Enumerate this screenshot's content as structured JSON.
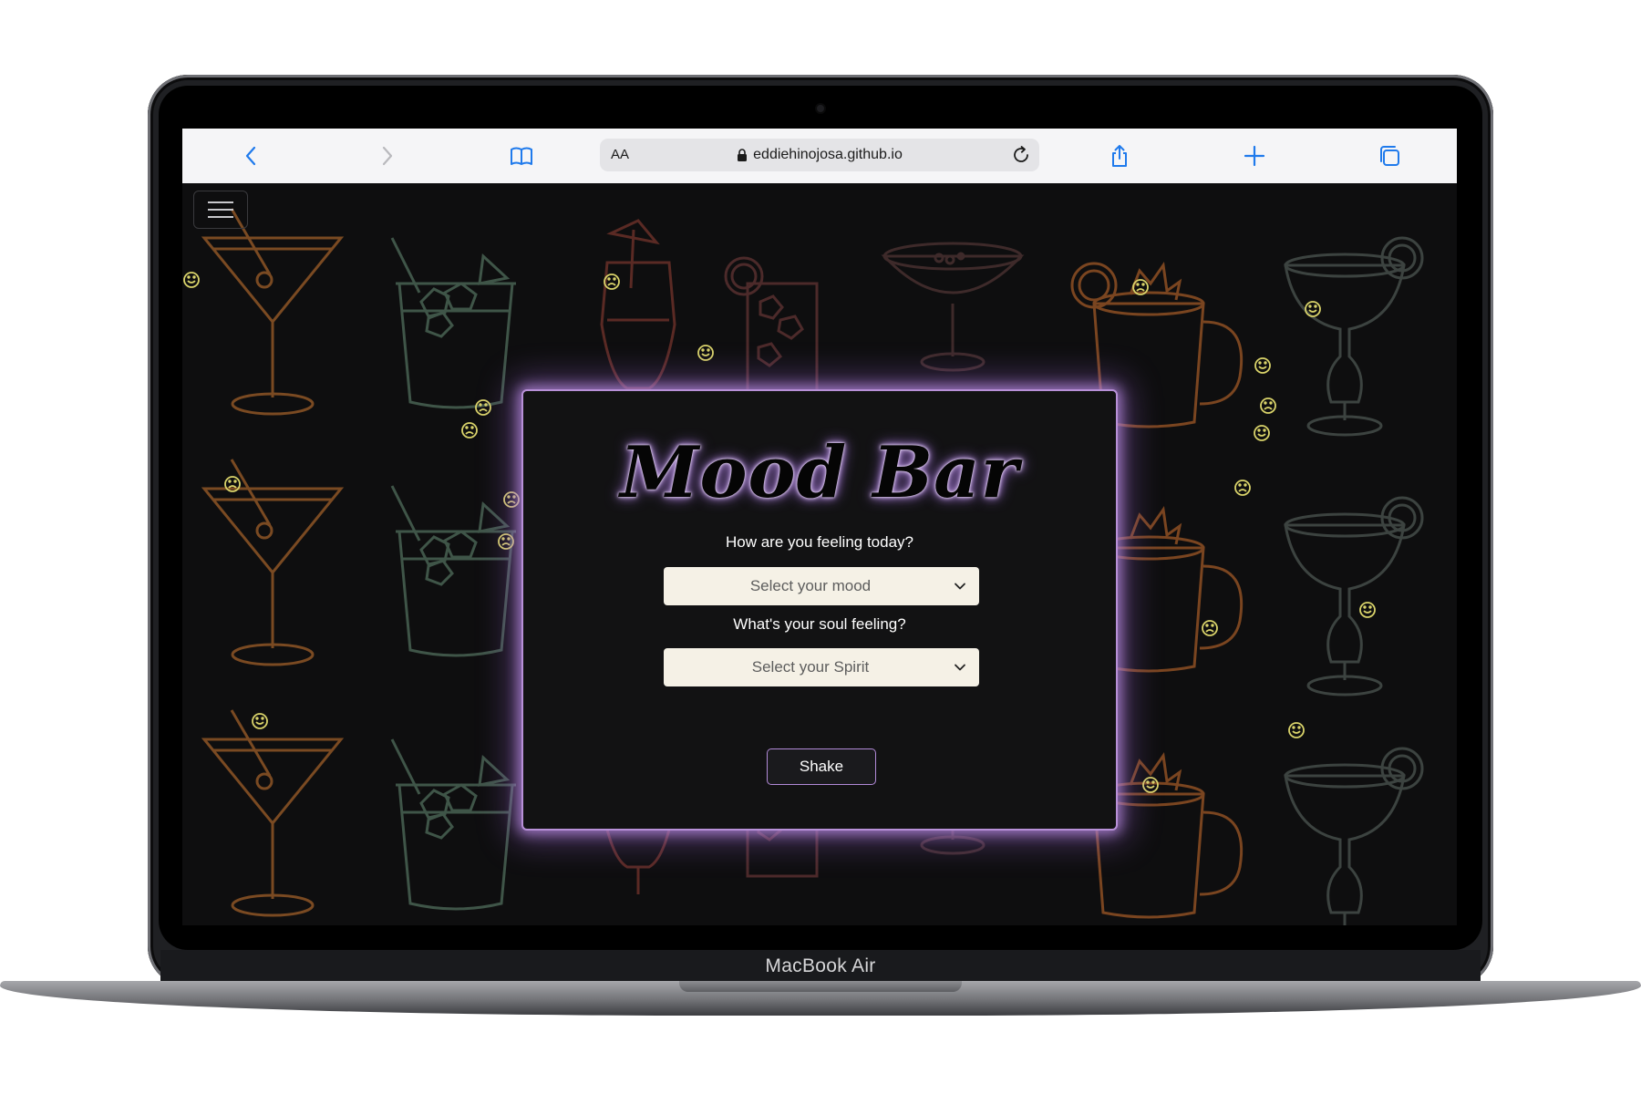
{
  "device": {
    "model_label": "MacBook Air"
  },
  "browser": {
    "text_size_label": "AA",
    "url": "eddiehinojosa.github.io",
    "icons": [
      "back-icon",
      "forward-icon",
      "bookmarks-icon",
      "lock-icon",
      "reload-icon",
      "share-icon",
      "new-tab-icon",
      "tabs-icon"
    ]
  },
  "page": {
    "menu_icon": "hamburger-menu-icon",
    "title": "Mood Bar",
    "mood_question": "How are you feeling today?",
    "mood_select": {
      "selected": "Select your mood"
    },
    "spirit_question": "What's your soul feeling?",
    "spirit_select": {
      "selected": "Select your Spirit"
    },
    "shake_label": "Shake"
  },
  "colors": {
    "accent_purple": "#b890d8",
    "card_bg": "#121213",
    "page_bg": "#0e0e0f",
    "select_bg": "#f5f1e6",
    "ios_blue": "#1f7aec",
    "emoji_yellow": "#d9d36a"
  }
}
